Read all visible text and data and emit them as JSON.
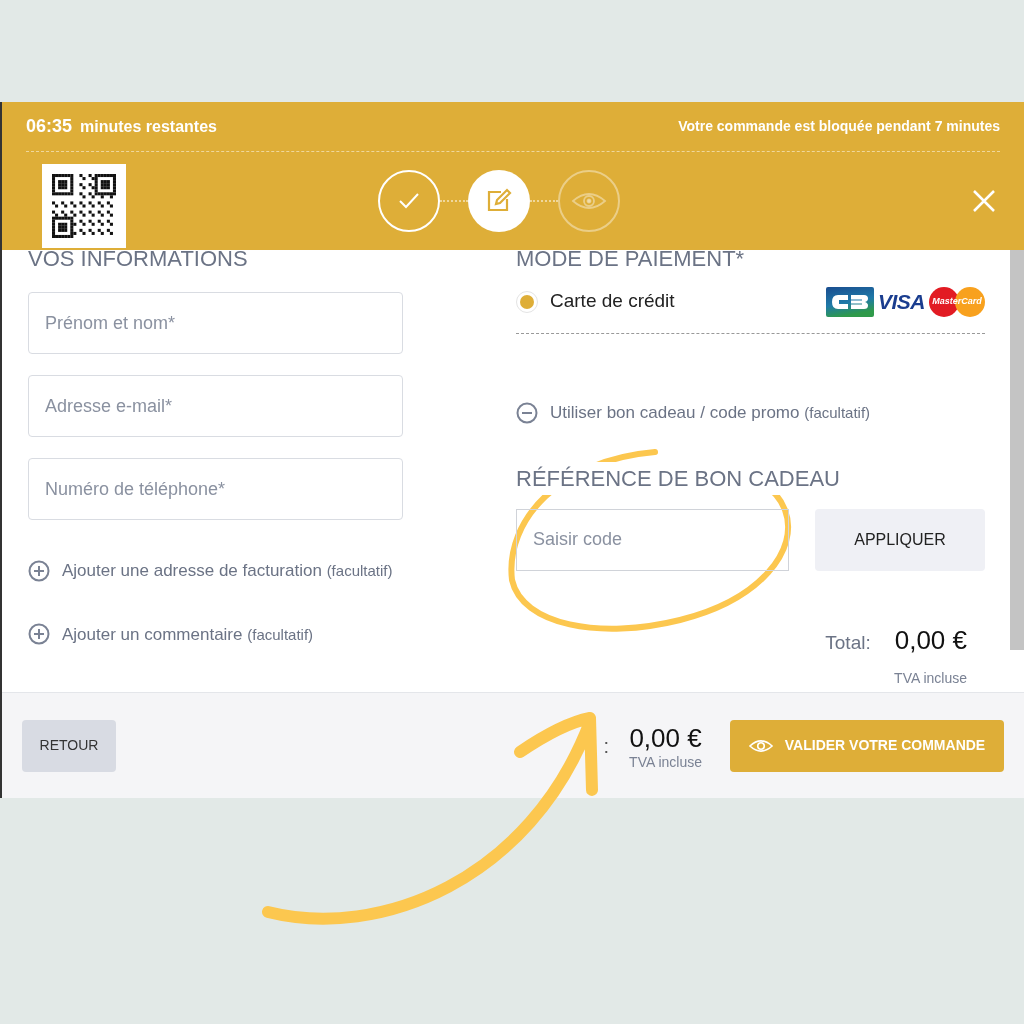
{
  "header": {
    "timer": "06:35",
    "timer_label": "minutes restantes",
    "notice": "Votre commande est bloquée pendant 7 minutes",
    "steps": [
      {
        "kind": "check",
        "done": true,
        "selected": false
      },
      {
        "kind": "edit",
        "done": false,
        "selected": true
      },
      {
        "kind": "eye",
        "done": false,
        "selected": false
      }
    ]
  },
  "info": {
    "title": "VOS INFORMATIONS",
    "fields": [
      {
        "placeholder": "Prénom et nom*"
      },
      {
        "placeholder": "Adresse e-mail*"
      },
      {
        "placeholder": "Numéro de téléphone*"
      }
    ],
    "options": [
      {
        "label": "Ajouter une adresse de facturation",
        "note": "(facultatif)",
        "expanded": false
      },
      {
        "label": "Ajouter un commentaire",
        "note": "(facultatif)",
        "expanded": false
      }
    ]
  },
  "payment": {
    "title": "MODE DE PAIEMENT*",
    "methods": [
      {
        "label": "Carte de crédit",
        "selected": true
      }
    ],
    "logos": [
      {
        "kind": "cb"
      },
      {
        "kind": "visa",
        "label": "VISA"
      },
      {
        "kind": "mastercard",
        "label": "MasterCard"
      }
    ],
    "promo": {
      "label": "Utiliser bon cadeau / code promo",
      "note": "(facultatif)",
      "expanded": true
    },
    "voucher_title": "RÉFÉRENCE DE BON CADEAU",
    "voucher_placeholder": "Saisir code",
    "apply": "APPLIQUER",
    "total_label": "Total:",
    "total": "0,00 €",
    "vat": "TVA incluse"
  },
  "footer": {
    "back": "RETOUR",
    "total_label": ":",
    "total": "0,00 €",
    "vat": "TVA incluse",
    "confirm": "VALIDER VOTRE COMMANDE"
  }
}
